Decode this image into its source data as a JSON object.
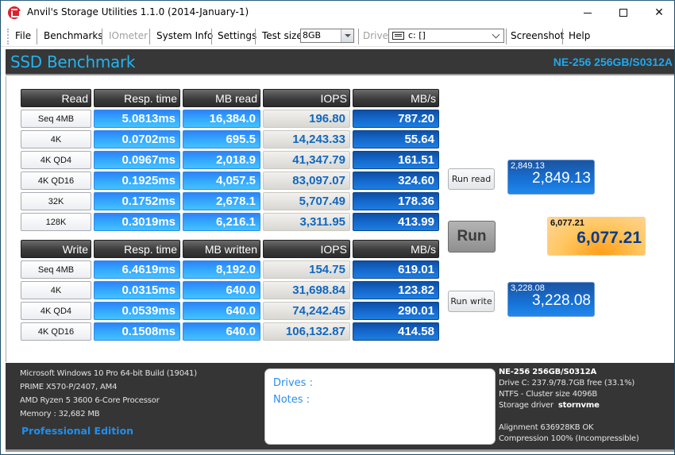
{
  "window": {
    "title": "Anvil's Storage Utilities 1.1.0 (2014-January-1)",
    "minimize": "minimize",
    "maximize": "maximize",
    "close": "✕"
  },
  "menu": {
    "file": "File",
    "benchmarks": "Benchmarks",
    "iometer": "IOmeter",
    "system_info": "System Info",
    "settings": "Settings",
    "test_size_label": "Test size",
    "test_size_value": "8GB",
    "drive_label": "Drive",
    "drive_value": "c: []",
    "screenshot": "Screenshot",
    "help": "Help"
  },
  "header": {
    "title": "SSD Benchmark",
    "drive": "NE-256 256GB/S0312A"
  },
  "read_table": {
    "headers": [
      "Read",
      "Resp. time",
      "MB read",
      "IOPS",
      "MB/s"
    ],
    "rows": [
      {
        "test": "Seq 4MB",
        "resp": "5.0813ms",
        "mb": "16,384.0",
        "iops": "196.80",
        "mbps": "787.20"
      },
      {
        "test": "4K",
        "resp": "0.0702ms",
        "mb": "695.5",
        "iops": "14,243.33",
        "mbps": "55.64"
      },
      {
        "test": "4K QD4",
        "resp": "0.0967ms",
        "mb": "2,018.9",
        "iops": "41,347.79",
        "mbps": "161.51"
      },
      {
        "test": "4K QD16",
        "resp": "0.1925ms",
        "mb": "4,057.5",
        "iops": "83,097.07",
        "mbps": "324.60"
      },
      {
        "test": "32K",
        "resp": "0.1752ms",
        "mb": "2,678.1",
        "iops": "5,707.49",
        "mbps": "178.36"
      },
      {
        "test": "128K",
        "resp": "0.3019ms",
        "mb": "6,216.1",
        "iops": "3,311.95",
        "mbps": "413.99"
      }
    ]
  },
  "write_table": {
    "headers": [
      "Write",
      "Resp. time",
      "MB written",
      "IOPS",
      "MB/s"
    ],
    "rows": [
      {
        "test": "Seq 4MB",
        "resp": "6.4619ms",
        "mb": "8,192.0",
        "iops": "154.75",
        "mbps": "619.01"
      },
      {
        "test": "4K",
        "resp": "0.0315ms",
        "mb": "640.0",
        "iops": "31,698.84",
        "mbps": "123.82"
      },
      {
        "test": "4K QD4",
        "resp": "0.0539ms",
        "mb": "640.0",
        "iops": "74,242.45",
        "mbps": "290.01"
      },
      {
        "test": "4K QD16",
        "resp": "0.1508ms",
        "mb": "640.0",
        "iops": "106,132.87",
        "mbps": "414.58"
      }
    ]
  },
  "controls": {
    "run_read": "Run read",
    "run": "Run",
    "run_write": "Run write"
  },
  "scores": {
    "read_small": "2,849.13",
    "read_big": "2,849.13",
    "total_small": "6,077.21",
    "total_big": "6,077.21",
    "write_small": "3,228.08",
    "write_big": "3,228.08"
  },
  "system": {
    "os": "Microsoft Windows 10 Pro 64-bit Build (19041)",
    "board": "PRIME X570-P/2407, AM4",
    "cpu": "AMD Ryzen 5 3600 6-Core Processor",
    "memory": "Memory : 32,682 MB",
    "edition": "Professional Edition"
  },
  "notes": {
    "drives": "Drives :",
    "notes": "Notes :"
  },
  "drive_info": {
    "model": "NE-256 256GB/S0312A",
    "space": "Drive C: 237.9/78.7GB free (33.1%)",
    "fs": "NTFS - Cluster size 4096B",
    "driver_label": "Storage driver",
    "driver_value": "stornvme",
    "alignment": "Alignment 636928KB OK",
    "compression": "Compression 100% (Incompressible)"
  }
}
